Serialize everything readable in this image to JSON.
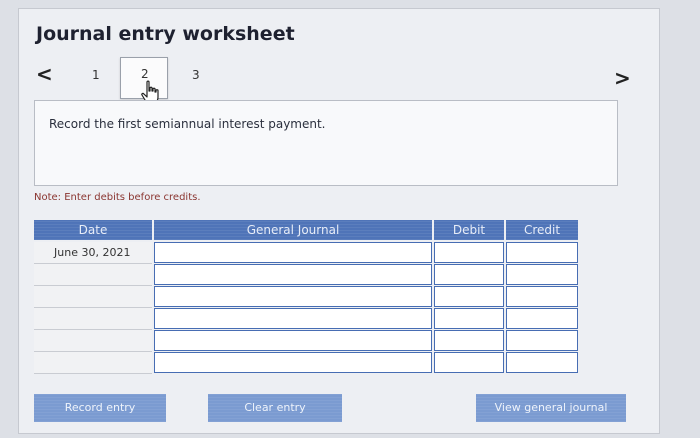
{
  "title": "Journal entry worksheet",
  "nav": {
    "prev": "<",
    "next": ">"
  },
  "steps": [
    "1",
    "2",
    "3"
  ],
  "instruction": "Record the first semiannual interest payment.",
  "note": "Note: Enter debits before credits.",
  "table": {
    "headers": [
      "Date",
      "General Journal",
      "Debit",
      "Credit"
    ],
    "rows": [
      {
        "date": "June 30, 2021",
        "general_journal": "",
        "debit": "",
        "credit": ""
      },
      {
        "date": "",
        "general_journal": "",
        "debit": "",
        "credit": ""
      },
      {
        "date": "",
        "general_journal": "",
        "debit": "",
        "credit": ""
      },
      {
        "date": "",
        "general_journal": "",
        "debit": "",
        "credit": ""
      },
      {
        "date": "",
        "general_journal": "",
        "debit": "",
        "credit": ""
      },
      {
        "date": "",
        "general_journal": "",
        "debit": "",
        "credit": ""
      }
    ]
  },
  "buttons": {
    "record": "Record entry",
    "clear": "Clear entry",
    "view": "View general journal"
  }
}
